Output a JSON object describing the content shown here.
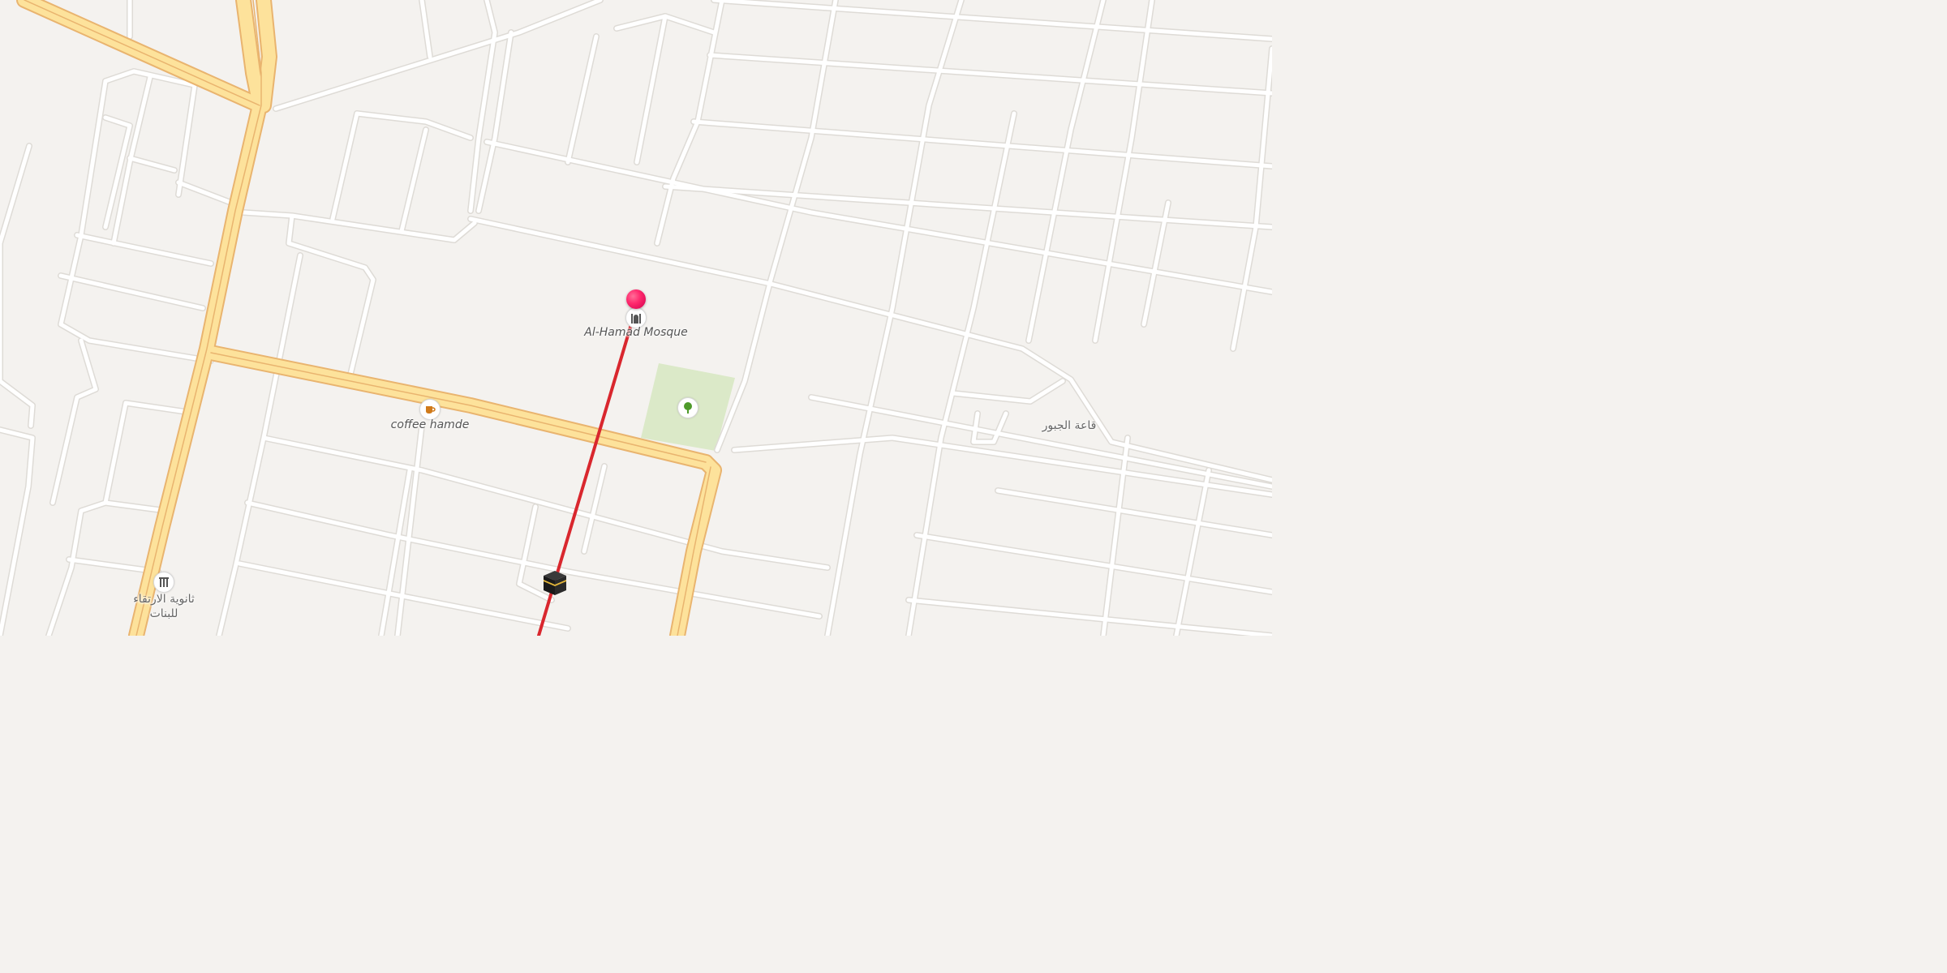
{
  "map": {
    "colors": {
      "background": "#f4f2ef",
      "street": "#ffffff",
      "street_casing": "#dedbd6",
      "arterial": "#fde29b",
      "arterial_casing": "#e9b46f",
      "park": "#dbe9c8",
      "qibla_line": "#d9272e",
      "pin": "#ff2a6e"
    },
    "pois": {
      "mosque": {
        "name": "Al-Hamad Mosque",
        "icon": "mosque-icon"
      },
      "coffee": {
        "name": "coffee hamde",
        "icon": "coffee-cup-icon"
      },
      "park": {
        "icon": "tree-icon"
      },
      "school": {
        "name_line1": "ثانوية الارتقاء",
        "name_line2": "للبنات",
        "icon": "school-icon"
      },
      "hall": {
        "name": "قاعة الجبور"
      }
    },
    "pin": {
      "icon": "location-pin-icon"
    },
    "qibla": {
      "icon": "kaaba-icon"
    }
  }
}
